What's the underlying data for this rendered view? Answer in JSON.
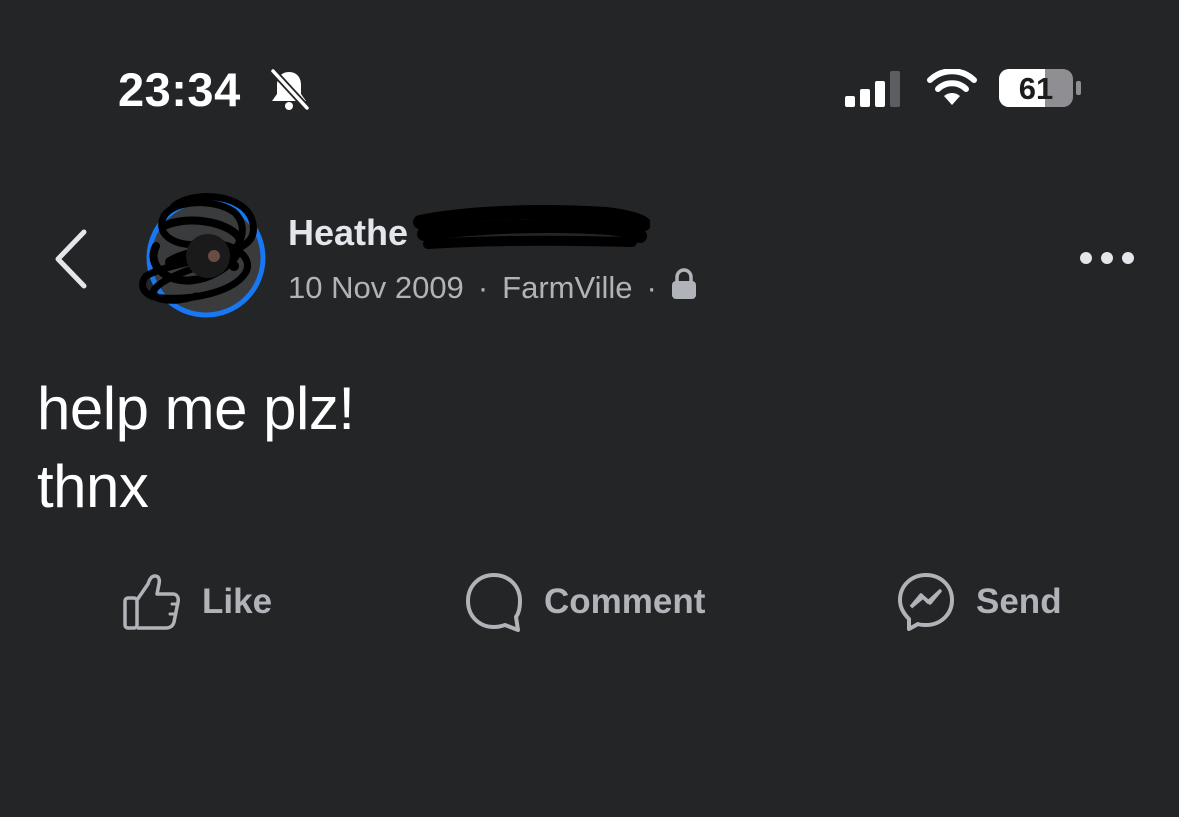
{
  "status_bar": {
    "time": "23:34",
    "bell_icon": "bell-slash-icon",
    "signal_icon": "cellular-signal-icon",
    "wifi_icon": "wifi-icon",
    "battery_percent": "61"
  },
  "post": {
    "author_visible": "Heathe",
    "date": "10 Nov 2009",
    "separator": "·",
    "app": "FarmVille",
    "privacy_icon": "lock-icon",
    "text_lines": [
      "help me plz!",
      "thnx"
    ]
  },
  "actions": {
    "like": "Like",
    "comment": "Comment",
    "send": "Send"
  },
  "colors": {
    "background": "#242527",
    "text_primary": "#ffffff",
    "text_secondary": "#b0b3b8",
    "avatar_ring": "#1877f2"
  }
}
